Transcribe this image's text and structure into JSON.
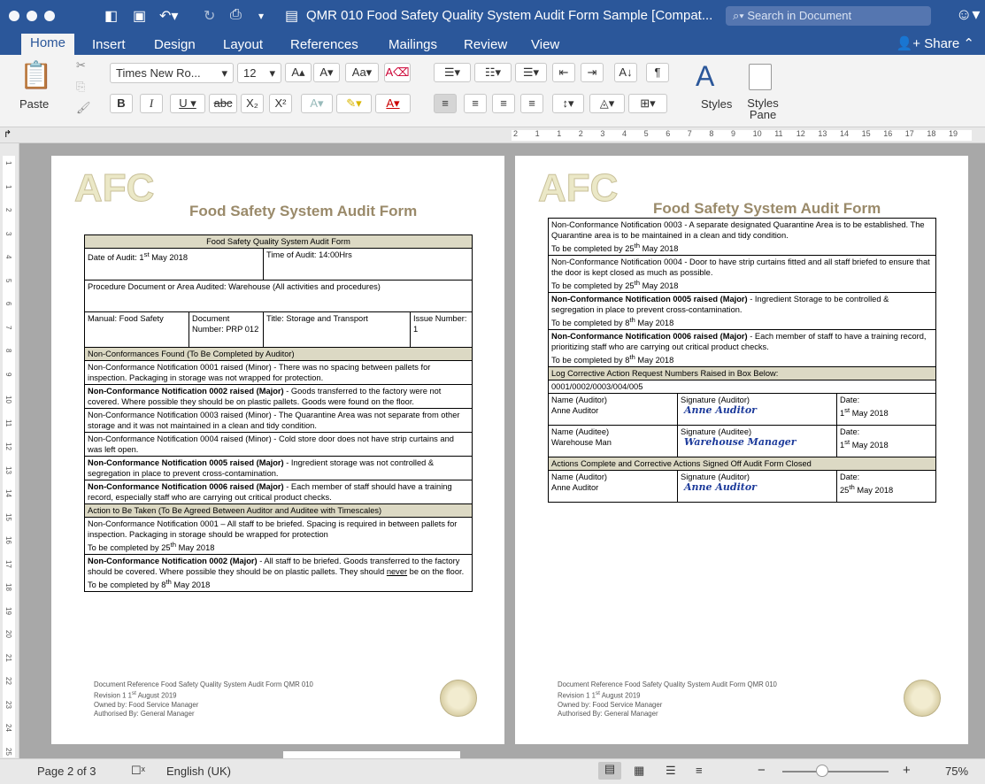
{
  "window": {
    "title": "QMR 010 Food Safety Quality System Audit Form Sample [Compat...",
    "search_placeholder": "Search in Document"
  },
  "tabs": [
    "Home",
    "Insert",
    "Design",
    "Layout",
    "References",
    "Mailings",
    "Review",
    "View"
  ],
  "share_label": "Share",
  "ribbon": {
    "paste_label": "Paste",
    "font_name": "Times New Ro...",
    "font_size": "12",
    "styles_label": "Styles",
    "styles_pane_label": "Styles Pane"
  },
  "ruler_labels": [
    "2",
    "1",
    "1",
    "2",
    "3",
    "4",
    "5",
    "6",
    "7",
    "8",
    "9",
    "10",
    "11",
    "12",
    "13",
    "14",
    "15",
    "16",
    "17",
    "18",
    "19"
  ],
  "vruler_labels": [
    "1",
    "1",
    "2",
    "3",
    "4",
    "5",
    "6",
    "7",
    "8",
    "9",
    "10",
    "11",
    "12",
    "13",
    "14",
    "15",
    "16",
    "17",
    "18",
    "19",
    "20",
    "21",
    "22",
    "23",
    "24",
    "25"
  ],
  "logo_text": "AFC",
  "page_title": "Food Safety System Audit Form",
  "page1": {
    "header": "Food Safety Quality System Audit Form",
    "date_of_audit": "Date of Audit: 1st May 2018",
    "time_of_audit": "Time of Audit: 14:00Hrs",
    "procedure": "Procedure Document or Area Audited: Warehouse (All activities and procedures)",
    "manual": "Manual: Food Safety",
    "doc_number": "Document Number: PRP 012",
    "title": "Title: Storage and Transport",
    "issue": "Issue Number: 1",
    "nc_header": "Non-Conformances Found (To Be Completed by Auditor)",
    "nc": [
      {
        "bold": "",
        "text": "Non-Conformance Notification 0001 raised (Minor) - There was no spacing between pallets for inspection. Packaging in storage was not wrapped for protection."
      },
      {
        "bold": "Non-Conformance Notification 0002 raised (Major)",
        "text": " - Goods transferred to the factory were not covered. Where possible they should be on plastic pallets. Goods were found on the floor."
      },
      {
        "bold": "",
        "text": "Non-Conformance Notification 0003 raised (Minor) - The Quarantine Area was not separate from other storage and it was not maintained in a clean and tidy condition."
      },
      {
        "bold": "",
        "text": "Non-Conformance Notification 0004 raised (Minor) - Cold store door does not have strip curtains and was left open."
      },
      {
        "bold": "Non-Conformance Notification 0005 raised (Major)",
        "text": " - Ingredient storage was not controlled & segregation in place to prevent cross-contamination."
      },
      {
        "bold": "Non-Conformance Notification 0006 raised (Major)",
        "text": " - Each member of staff should have a training record, especially staff who are carrying out critical product checks."
      }
    ],
    "action_header": "Action to Be Taken (To Be Agreed Between Auditor and Auditee with Timescales)",
    "action1": "Non-Conformance Notification 0001 – All staff to be briefed. Spacing is required in between pallets for inspection. Packaging in storage should be wrapped for protection",
    "action1_due": "To be completed by 25th May 2018",
    "action2_bold": "Non-Conformance Notification 0002 (Major)",
    "action2": " - All staff to be briefed. Goods transferred to the factory should be covered. Where possible they should be on plastic pallets. They should never be on the floor.",
    "action2_due": "To be completed by 8th May 2018"
  },
  "page2": {
    "rows": [
      {
        "bold": "",
        "text": "Non-Conformance Notification 0003 - A separate designated Quarantine Area is to be established. The Quarantine area is to be maintained in a clean and tidy condition.",
        "due": "To be completed by 25th May 2018"
      },
      {
        "bold": "",
        "text": "Non-Conformance Notification 0004 - Door to have strip curtains fitted and all staff briefed to ensure that the door is kept closed as much as possible.",
        "due": "To be completed by 25th May 2018"
      },
      {
        "bold": "Non-Conformance Notification 0005 raised (Major)",
        "text": " - Ingredient Storage to be controlled & segregation in place to prevent cross-contamination.",
        "due": "To be completed by 8th May 2018"
      },
      {
        "bold": "Non-Conformance Notification 0006 raised (Major)",
        "text": " - Each member of staff to have a training record, prioritizing staff who are carrying out critical product checks.",
        "due": "To be completed by 8th May 2018"
      }
    ],
    "log_header": "Log Corrective Action Request Numbers Raised in Box Below:",
    "log_value": "0001/0002/0003/004/005",
    "sign_rows": [
      {
        "name_label": "Name (Auditor)",
        "name": "Anne Auditor",
        "sig_label": "Signature (Auditor)",
        "sig": "Anne Auditor",
        "date_label": "Date:",
        "date": "1st May 2018"
      },
      {
        "name_label": "Name (Auditee)",
        "name": "Warehouse Man",
        "sig_label": "Signature (Auditee)",
        "sig": "Warehouse Manager",
        "date_label": "Date:",
        "date": "1st May 2018"
      }
    ],
    "closed_header": "Actions Complete and Corrective Actions Signed Off Audit Form Closed",
    "closed_row": {
      "name_label": "Name (Auditor)",
      "name": "Anne Auditor",
      "sig_label": "Signature (Auditor)",
      "sig": "Anne Auditor",
      "date_label": "Date:",
      "date": "25th May 2018"
    }
  },
  "footer": [
    "Document Reference Food Safety Quality System Audit Form QMR 010",
    "Revision 1  1st August 2019",
    "Owned by: Food Service Manager",
    "Authorised By: General Manager"
  ],
  "status": {
    "page": "Page 2 of 3",
    "language": "English (UK)",
    "zoom": "75%"
  }
}
